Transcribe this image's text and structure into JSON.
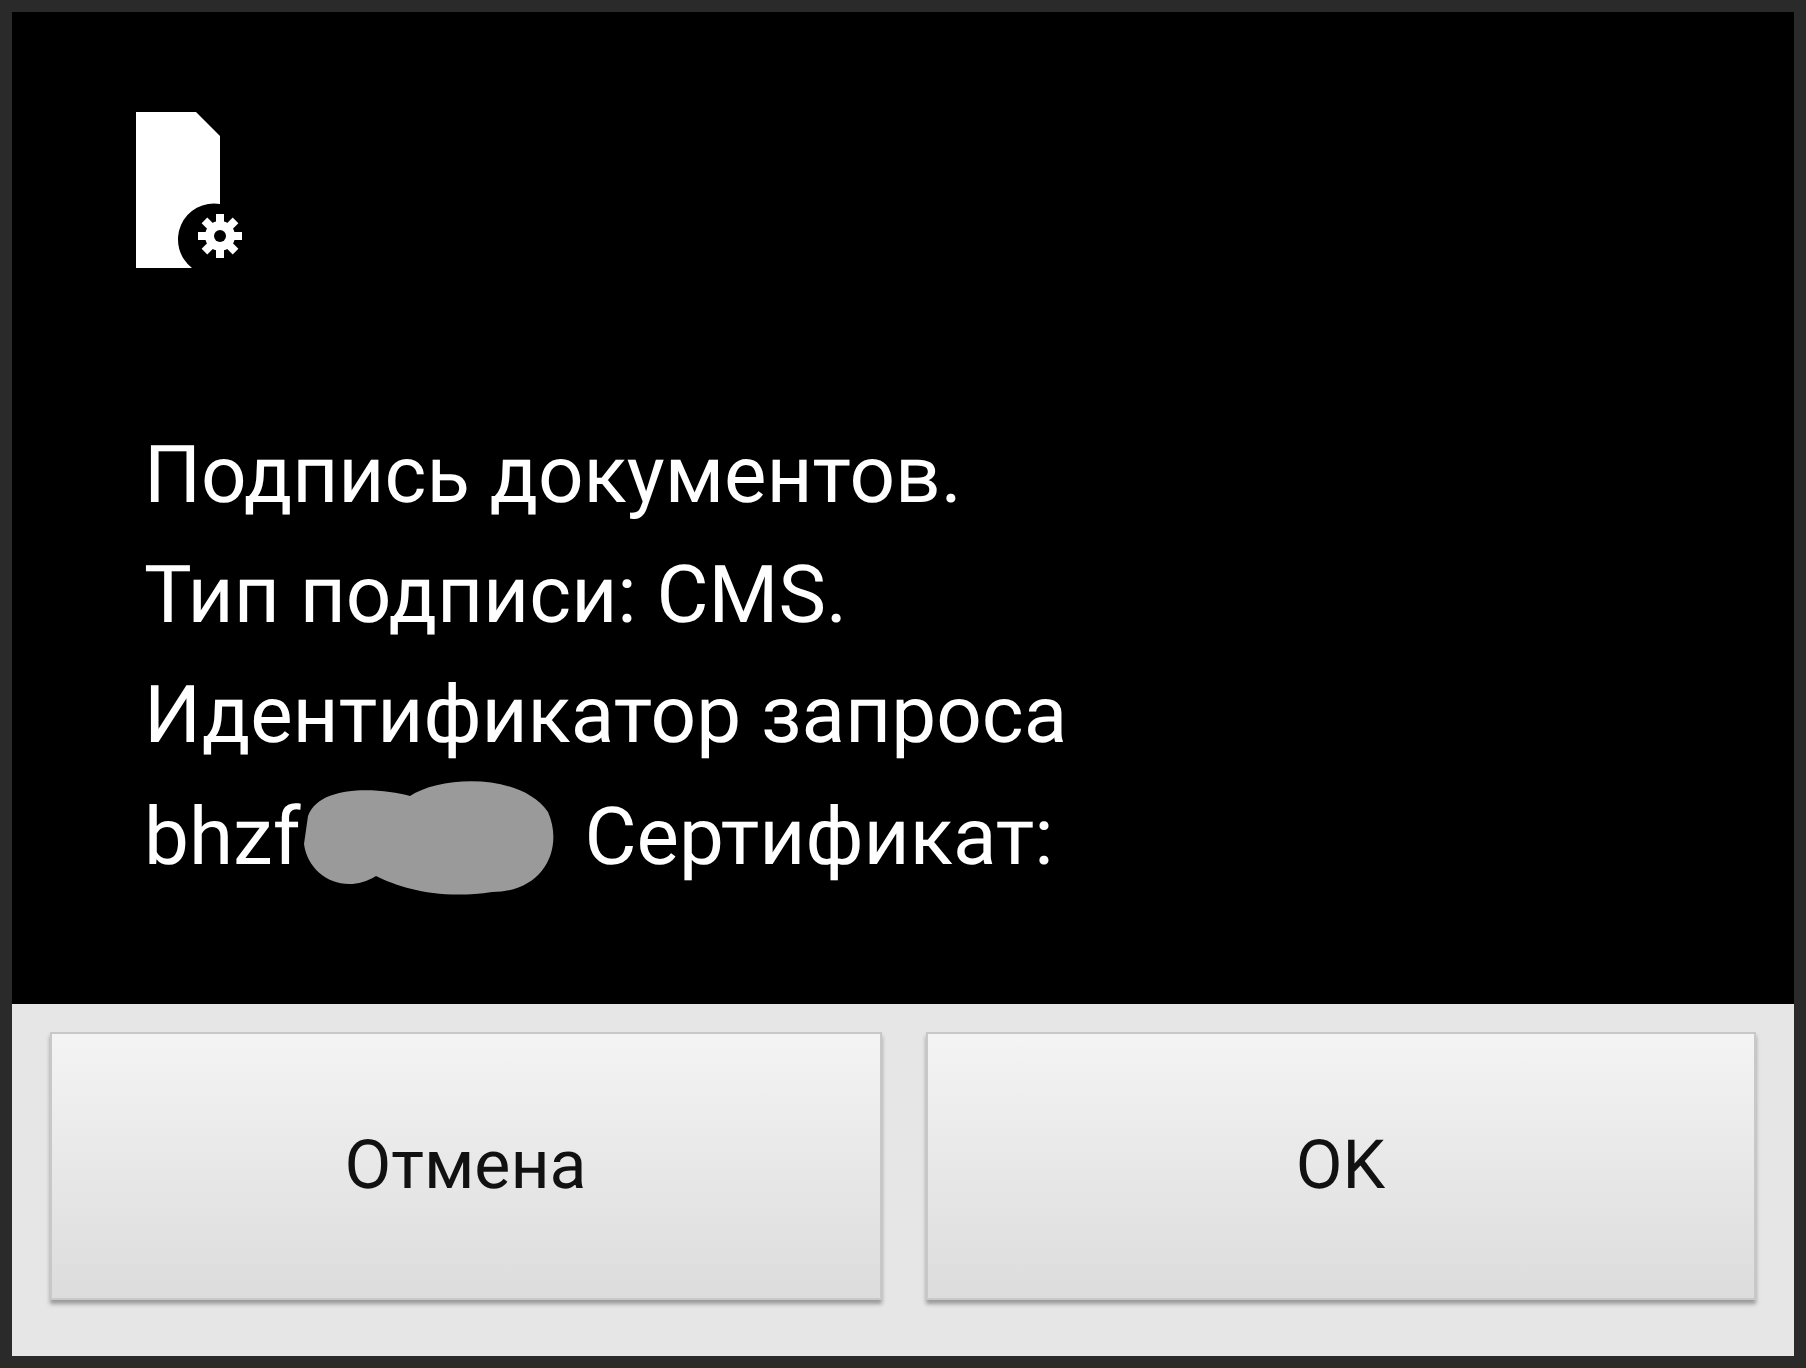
{
  "dialog": {
    "message_lines": [
      "Подпись документов.",
      "Тип подписи: CMS.",
      "Идентификатор запроса"
    ],
    "request_line": {
      "prefix": "bhzf",
      "redacted": true,
      "suffix": "Сертификат:"
    },
    "buttons": [
      {
        "label": "Отмена"
      },
      {
        "label": "OK"
      }
    ]
  }
}
